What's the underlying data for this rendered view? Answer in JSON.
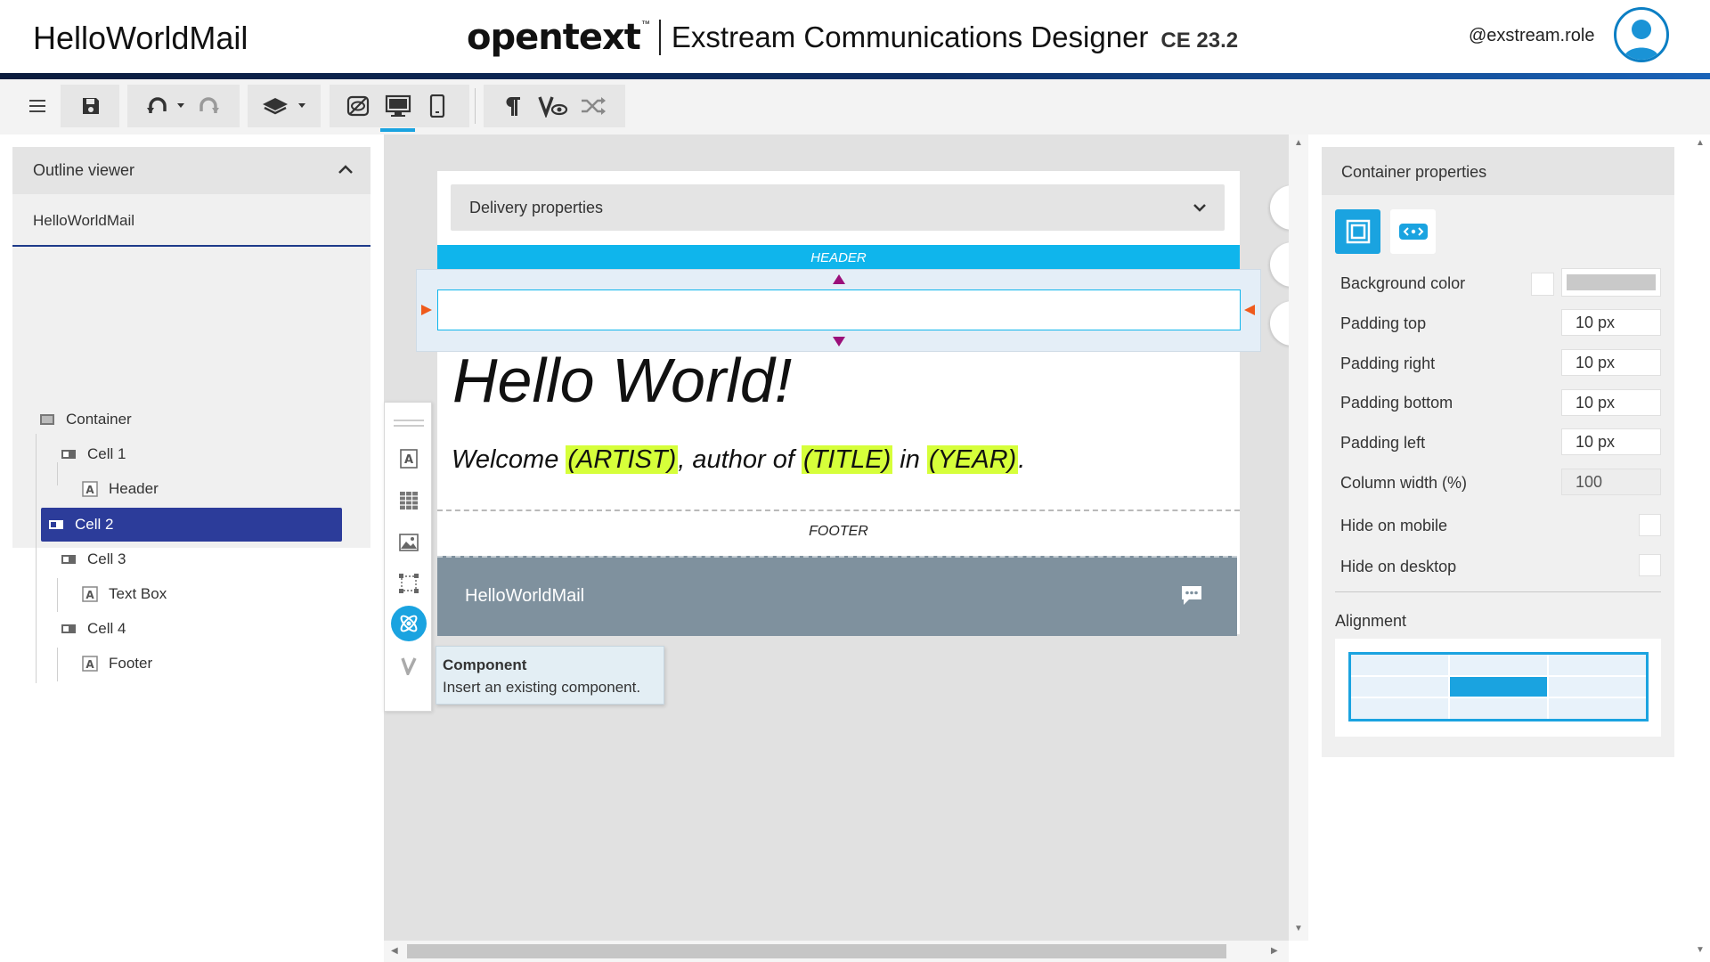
{
  "header": {
    "app_name": "HelloWorldMail",
    "brand_logo": "opentext",
    "brand_tm": "™",
    "product": "Exstream Communications Designer",
    "version": "CE 23.2",
    "user": "@exstream.role"
  },
  "toolbar": {
    "buttons": [
      "menu-icon",
      "save-icon",
      "undo-icon",
      "redo-icon",
      "layers-icon",
      "hide-icon",
      "desktop-view-icon",
      "mobile-view-icon",
      "paragraph-icon",
      "validate-icon",
      "shuffle-icon"
    ],
    "active_view": "desktop"
  },
  "outline": {
    "title": "Outline viewer",
    "document": "HelloWorldMail",
    "items": [
      {
        "label": "Container",
        "level": 0,
        "icon": "container-icon"
      },
      {
        "label": "Cell 1",
        "level": 1,
        "icon": "cell-icon"
      },
      {
        "label": "Header",
        "level": 2,
        "icon": "text-icon"
      },
      {
        "label": "Cell 2",
        "level": 1,
        "icon": "cell-icon",
        "selected": true
      },
      {
        "label": "Cell 3",
        "level": 1,
        "icon": "cell-icon"
      },
      {
        "label": "Text Box",
        "level": 2,
        "icon": "text-icon"
      },
      {
        "label": "Cell 4",
        "level": 1,
        "icon": "cell-icon"
      },
      {
        "label": "Footer",
        "level": 2,
        "icon": "text-icon"
      }
    ]
  },
  "canvas": {
    "delivery_label": "Delivery properties",
    "header_label": "HEADER",
    "hello_title": "Hello World!",
    "welcome": {
      "prefix": "Welcome ",
      "artist": "(ARTIST)",
      "mid1": ", author of ",
      "title": "(TITLE)",
      "mid2": " in ",
      "year": "(YEAR)",
      "suffix": "."
    },
    "footer_label": "FOOTER",
    "footer_bar_text": "HelloWorldMail"
  },
  "palette": {
    "items": [
      "drag-handle-icon",
      "text-icon",
      "table-icon",
      "image-icon",
      "container-icon",
      "component-icon",
      "variable-icon"
    ],
    "active": "component-icon",
    "tooltip_title": "Component",
    "tooltip_desc": "Insert an existing component."
  },
  "properties": {
    "title": "Container properties",
    "background_color_label": "Background color",
    "padding_top_label": "Padding top",
    "padding_top": "10 px",
    "padding_right_label": "Padding right",
    "padding_right": "10 px",
    "padding_bottom_label": "Padding bottom",
    "padding_bottom": "10 px",
    "padding_left_label": "Padding left",
    "padding_left": "10 px",
    "column_width_label": "Column width (%)",
    "column_width": "100",
    "hide_mobile_label": "Hide on mobile",
    "hide_desktop_label": "Hide on desktop",
    "alignment_label": "Alignment",
    "alignment_selected": "center"
  },
  "colors": {
    "accent": "#1aa3e0",
    "header_band": "#0fb5ec",
    "selection": "#2c3c9a",
    "highlight": "#d6ff3a",
    "footer_bar": "#7f919e",
    "marker_vertical": "#9b0f7a",
    "marker_horizontal": "#ef5a1c"
  }
}
